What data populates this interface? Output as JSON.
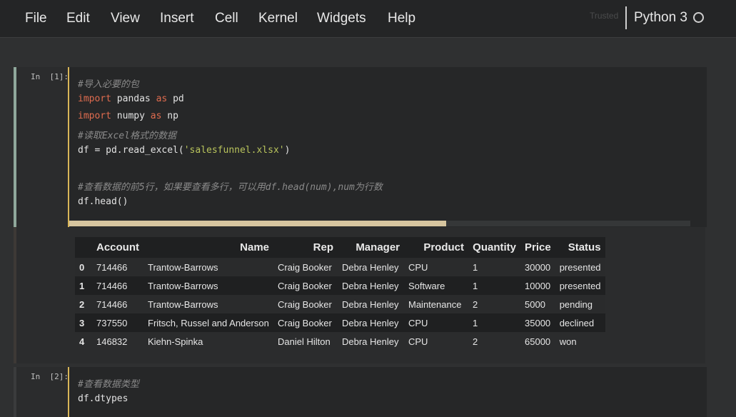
{
  "menubar": {
    "items": [
      "File",
      "Edit",
      "View",
      "Insert",
      "Cell",
      "Kernel",
      "Widgets",
      "Help"
    ],
    "trusted_label": "Trusted",
    "kernel_name": "Python 3"
  },
  "cell1": {
    "prompt": "In  [1]:",
    "code_lines": [
      "#导入必要的包",
      "import pandas as pd",
      "import numpy as np",
      "#读取Excel格式的数据",
      "df = pd.read_excel('salesfunnel.xlsx')",
      "",
      "#查看数据的前5行，如果要查看多行，可以用df.head(num),num为行数",
      "df.head()"
    ]
  },
  "output1": {
    "columns": [
      "Account",
      "Name",
      "Rep",
      "Manager",
      "Product",
      "Quantity",
      "Price",
      "Status"
    ],
    "rows": [
      {
        "index": "0",
        "values": [
          "714466",
          "Trantow-Barrows",
          "Craig Booker",
          "Debra Henley",
          "CPU",
          "1",
          "30000",
          "presented"
        ]
      },
      {
        "index": "1",
        "values": [
          "714466",
          "Trantow-Barrows",
          "Craig Booker",
          "Debra Henley",
          "Software",
          "1",
          "10000",
          "presented"
        ]
      },
      {
        "index": "2",
        "values": [
          "714466",
          "Trantow-Barrows",
          "Craig Booker",
          "Debra Henley",
          "Maintenance",
          "2",
          "5000",
          "pending"
        ]
      },
      {
        "index": "3",
        "values": [
          "737550",
          "Fritsch, Russel and Anderson",
          "Craig Booker",
          "Debra Henley",
          "CPU",
          "1",
          "35000",
          "declined"
        ]
      },
      {
        "index": "4",
        "values": [
          "146832",
          "Kiehn-Spinka",
          "Daniel Hilton",
          "Debra Henley",
          "CPU",
          "2",
          "65000",
          "won"
        ]
      }
    ]
  },
  "cell2": {
    "prompt": "In  [2]:",
    "code_lines": [
      "#查看数据类型",
      "df.dtypes"
    ]
  }
}
